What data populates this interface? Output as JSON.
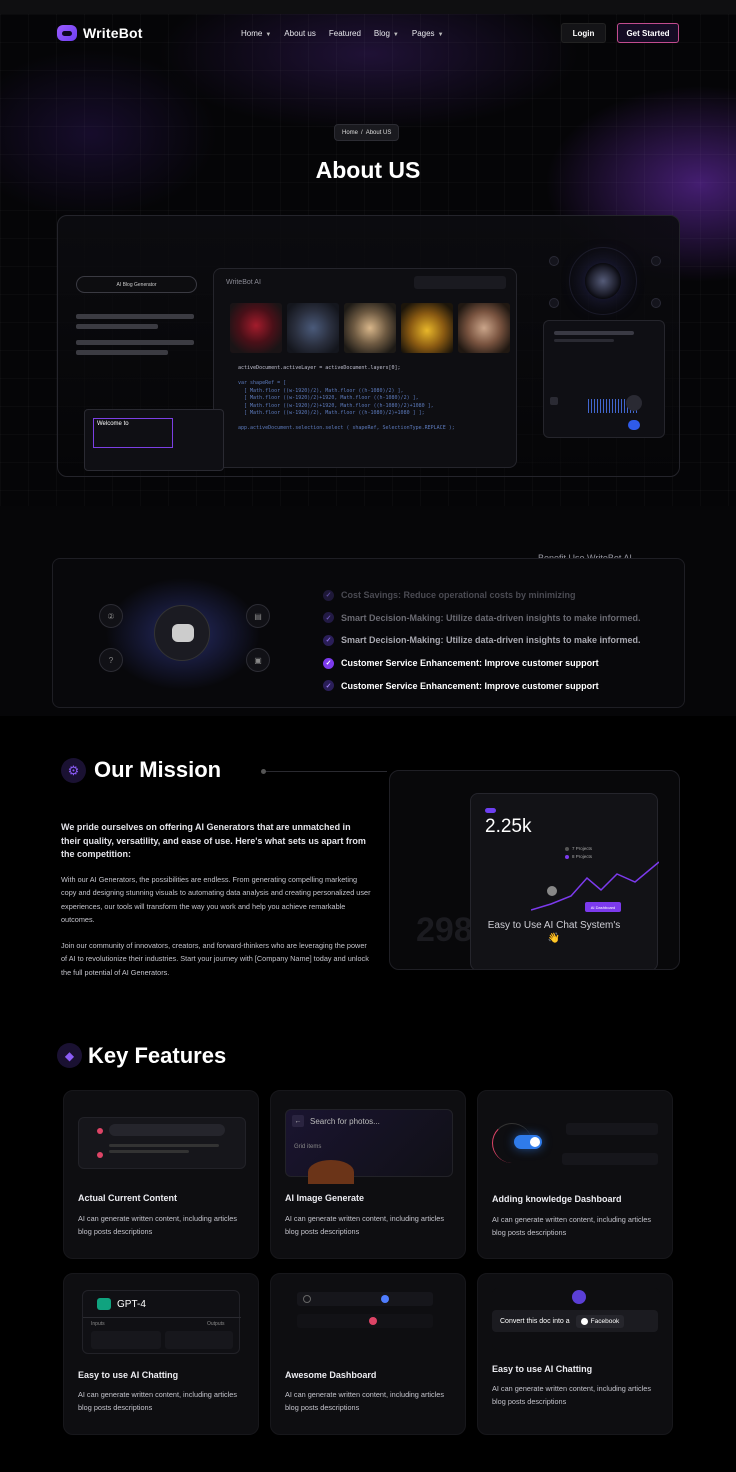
{
  "brand": {
    "name": "WriteBot",
    "accent": "#7c3aed"
  },
  "nav": {
    "items": [
      {
        "label": "Home",
        "dropdown": true
      },
      {
        "label": "About us",
        "dropdown": false
      },
      {
        "label": "Featured",
        "dropdown": false
      },
      {
        "label": "Blog",
        "dropdown": true
      },
      {
        "label": "Pages",
        "dropdown": true
      }
    ],
    "login": "Login",
    "get_started": "Get Started"
  },
  "hero": {
    "breadcrumb": {
      "home": "Home",
      "sep": "/",
      "current": "About US"
    },
    "title": "About US"
  },
  "showcase": {
    "pill": "AI Blog Generator",
    "app_title": "WriteBot AI",
    "welcome": "Welcome to"
  },
  "benefits": {
    "heading": "Benefit Use WriteBot AI",
    "items": [
      {
        "text": "Cost Savings: Reduce operational costs by minimizing",
        "active": false
      },
      {
        "text": "Smart Decision-Making: Utilize data-driven insights to make informed.",
        "active": false
      },
      {
        "text": "Smart Decision-Making: Utilize data-driven insights to make informed.",
        "active": false
      },
      {
        "text": "Customer Service Enhancement: Improve customer support",
        "active": true
      },
      {
        "text": "Customer Service Enhancement: Improve customer support",
        "active": true
      }
    ]
  },
  "mission": {
    "title": "Our Mission",
    "lead": "We pride ourselves on offering AI Generators that are unmatched in their quality, versatility, and ease of use. Here's what sets us apart from the competition:",
    "p1": "With our AI Generators, the possibilities are endless. From generating compelling marketing copy and designing stunning visuals to automating data analysis and creating personalized user experiences, our tools will transform the way you work and help you achieve remarkable outcomes.",
    "p2": "Join our community of innovators, creators, and forward-thinkers who are leveraging the power of AI to revolutionize their industries. Start your journey with [Company Name] today and unlock the full potential of AI Generators.",
    "card": {
      "value": "2.25k",
      "legend": [
        "7 Projects",
        "8 Projects"
      ],
      "tag": "AI Dashboard",
      "caption": "Easy to Use AI Chat System's👋",
      "faded_number": "298"
    }
  },
  "features": {
    "title": "Key Features",
    "cards": [
      {
        "title": "Actual Current Content",
        "desc": "AI can generate written content, including articles blog posts descriptions"
      },
      {
        "title": "AI Image Generate",
        "desc": "AI can generate written content, including articles blog posts descriptions",
        "search": "Search for photos...",
        "sub": "Grid items"
      },
      {
        "title": "Adding knowledge Dashboard",
        "desc": "AI can generate written content, including articles blog posts descriptions"
      },
      {
        "title": "Easy to use AI Chatting",
        "desc": "AI can generate written content, including articles blog posts descriptions",
        "badge": "GPT-4",
        "inputs": "Inputs",
        "outputs": "Outputs"
      },
      {
        "title": "Awesome Dashboard",
        "desc": "AI can generate written content, including articles blog posts descriptions"
      },
      {
        "title": "Easy to use AI Chatting",
        "desc": "AI can generate written content, including articles blog posts descriptions",
        "convert": "Convert this doc into a",
        "target": "Facebook"
      }
    ]
  }
}
